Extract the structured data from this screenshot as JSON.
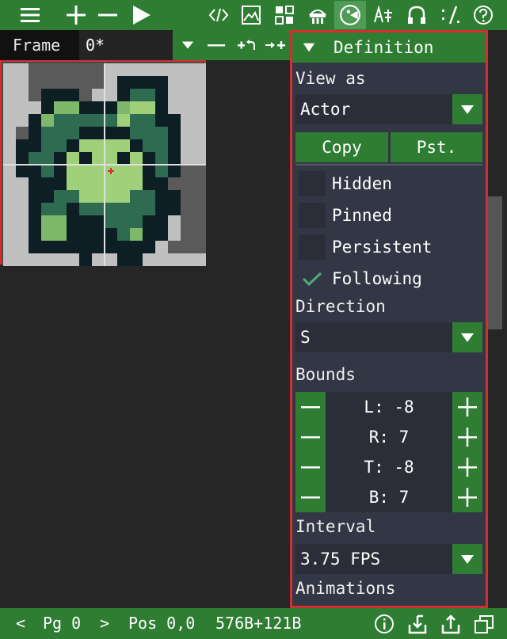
{
  "toolbar": {
    "icons": [
      "menu-icon",
      "add-icon",
      "remove-icon",
      "play-icon",
      "code-icon",
      "image-icon",
      "tiles-icon",
      "actor-icon",
      "sprite-icon",
      "font-icon",
      "audio-icon",
      "music-icon",
      "help-icon"
    ]
  },
  "frame": {
    "label": "Frame",
    "value": "0*"
  },
  "subtools": [
    "expand",
    "remove",
    "rotate",
    "shift"
  ],
  "panel": {
    "header": "Definition",
    "view_as_label": "View as",
    "view_as_value": "Actor",
    "copy_label": "Copy",
    "paste_label": "Pst.",
    "checks": [
      {
        "label": "Hidden",
        "checked": false
      },
      {
        "label": "Pinned",
        "checked": false
      },
      {
        "label": "Persistent",
        "checked": false
      },
      {
        "label": "Following",
        "checked": true
      }
    ],
    "direction_label": "Direction",
    "direction_value": "S",
    "bounds_label": "Bounds",
    "bounds": [
      "L: -8",
      "R: 7",
      "T: -8",
      "B: 7"
    ],
    "interval_label": "Interval",
    "interval_value": "3.75 FPS",
    "animations_label": "Animations"
  },
  "status": {
    "prev": "<",
    "page": "Pg 0",
    "next": ">",
    "pos": "Pos 0,0",
    "size": "576B+121B"
  },
  "colors": {
    "accent": "#2e7d32",
    "panel": "#333745",
    "highlight": "#d32f2f"
  }
}
